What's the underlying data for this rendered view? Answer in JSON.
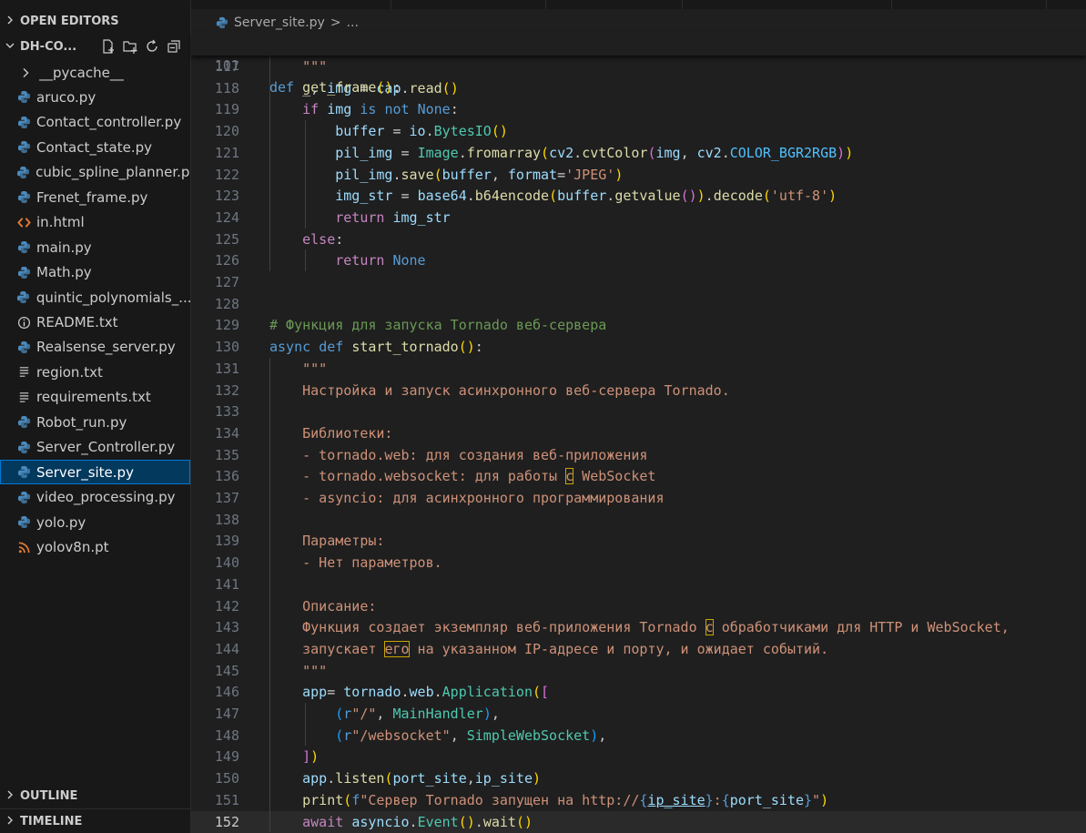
{
  "sidebar": {
    "open_editors_label": "OPEN EDITORS",
    "folder_label": "DH-CO...",
    "outline_label": "OUTLINE",
    "timeline_label": "TIMELINE",
    "files": [
      {
        "label": "__pycache__",
        "icon": "chevron-right-icon"
      },
      {
        "label": "aruco.py",
        "icon": "python-icon"
      },
      {
        "label": "Contact_controller.py",
        "icon": "python-icon"
      },
      {
        "label": "Contact_state.py",
        "icon": "python-icon"
      },
      {
        "label": "cubic_spline_planner.py",
        "icon": "python-icon"
      },
      {
        "label": "Frenet_frame.py",
        "icon": "python-icon"
      },
      {
        "label": "in.html",
        "icon": "html-icon"
      },
      {
        "label": "main.py",
        "icon": "python-icon"
      },
      {
        "label": "Math.py",
        "icon": "python-icon"
      },
      {
        "label": "quintic_polynomials_...",
        "icon": "python-icon"
      },
      {
        "label": "README.txt",
        "icon": "info-icon"
      },
      {
        "label": "Realsense_server.py",
        "icon": "python-icon"
      },
      {
        "label": "region.txt",
        "icon": "text-lines-icon"
      },
      {
        "label": "requirements.txt",
        "icon": "text-lines-icon"
      },
      {
        "label": "Robot_run.py",
        "icon": "python-icon"
      },
      {
        "label": "Server_Controller.py",
        "icon": "python-icon"
      },
      {
        "label": "Server_site.py",
        "icon": "python-icon"
      },
      {
        "label": "video_processing.py",
        "icon": "python-icon"
      },
      {
        "label": "yolo.py",
        "icon": "python-icon"
      },
      {
        "label": "yolov8n.pt",
        "icon": "rss-icon"
      }
    ],
    "selected": "Server_site.py"
  },
  "breadcrumb": {
    "file": "Server_site.py",
    "sep": ">",
    "rest": "..."
  },
  "colors": {
    "accent": "#0078d4",
    "selection": "#04395e",
    "python_icon": "#4b8bbe",
    "html_icon": "#e37933"
  },
  "code": {
    "sticky": {
      "num": "101",
      "text": "def get_frame():"
    },
    "lines": [
      {
        "num": "117",
        "text": "    \"\"\""
      },
      {
        "num": "118",
        "text": "    _, img = cap.read()"
      },
      {
        "num": "119",
        "text": "    if img is not None:"
      },
      {
        "num": "120",
        "text": "        buffer = io.BytesIO()"
      },
      {
        "num": "121",
        "text": "        pil_img = Image.fromarray(cv2.cvtColor(img, cv2.COLOR_BGR2RGB))"
      },
      {
        "num": "122",
        "text": "        pil_img.save(buffer, format='JPEG')"
      },
      {
        "num": "123",
        "text": "        img_str = base64.b64encode(buffer.getvalue()).decode('utf-8')"
      },
      {
        "num": "124",
        "text": "        return img_str"
      },
      {
        "num": "125",
        "text": "    else:"
      },
      {
        "num": "126",
        "text": "        return None"
      },
      {
        "num": "127",
        "text": ""
      },
      {
        "num": "128",
        "text": ""
      },
      {
        "num": "129",
        "text": "# Функция для запуска Tornado веб-сервера"
      },
      {
        "num": "130",
        "text": "async def start_tornado():"
      },
      {
        "num": "131",
        "text": "    \"\"\""
      },
      {
        "num": "132",
        "text": "    Настройка и запуск асинхронного веб-сервера Tornado."
      },
      {
        "num": "133",
        "text": ""
      },
      {
        "num": "134",
        "text": "    Библиотеки:"
      },
      {
        "num": "135",
        "text": "    - tornado.web: для создания веб-приложения"
      },
      {
        "num": "136",
        "text": "    - tornado.websocket: для работы с WebSocket"
      },
      {
        "num": "137",
        "text": "    - asyncio: для асинхронного программирования"
      },
      {
        "num": "138",
        "text": ""
      },
      {
        "num": "139",
        "text": "    Параметры:"
      },
      {
        "num": "140",
        "text": "    - Нет параметров."
      },
      {
        "num": "141",
        "text": ""
      },
      {
        "num": "142",
        "text": "    Описание:"
      },
      {
        "num": "143",
        "text": "    Функция создает экземпляр веб-приложения Tornado с обработчиками для HTTP и WebSocket,"
      },
      {
        "num": "144",
        "text": "    запускает его на указанном IP-адресе и порту, и ожидает событий."
      },
      {
        "num": "145",
        "text": "    \"\"\""
      },
      {
        "num": "146",
        "text": "    app= tornado.web.Application(["
      },
      {
        "num": "147",
        "text": "        (r\"/\", MainHandler),"
      },
      {
        "num": "148",
        "text": "        (r\"/websocket\", SimpleWebSocket),"
      },
      {
        "num": "149",
        "text": "    ])"
      },
      {
        "num": "150",
        "text": "    app.listen(port_site,ip_site)"
      },
      {
        "num": "151",
        "text": "    print(f\"Сервер Tornado запущен на http://{ip_site}:{port_site}\")"
      },
      {
        "num": "152",
        "text": "    await asyncio.Event().wait()"
      }
    ]
  }
}
